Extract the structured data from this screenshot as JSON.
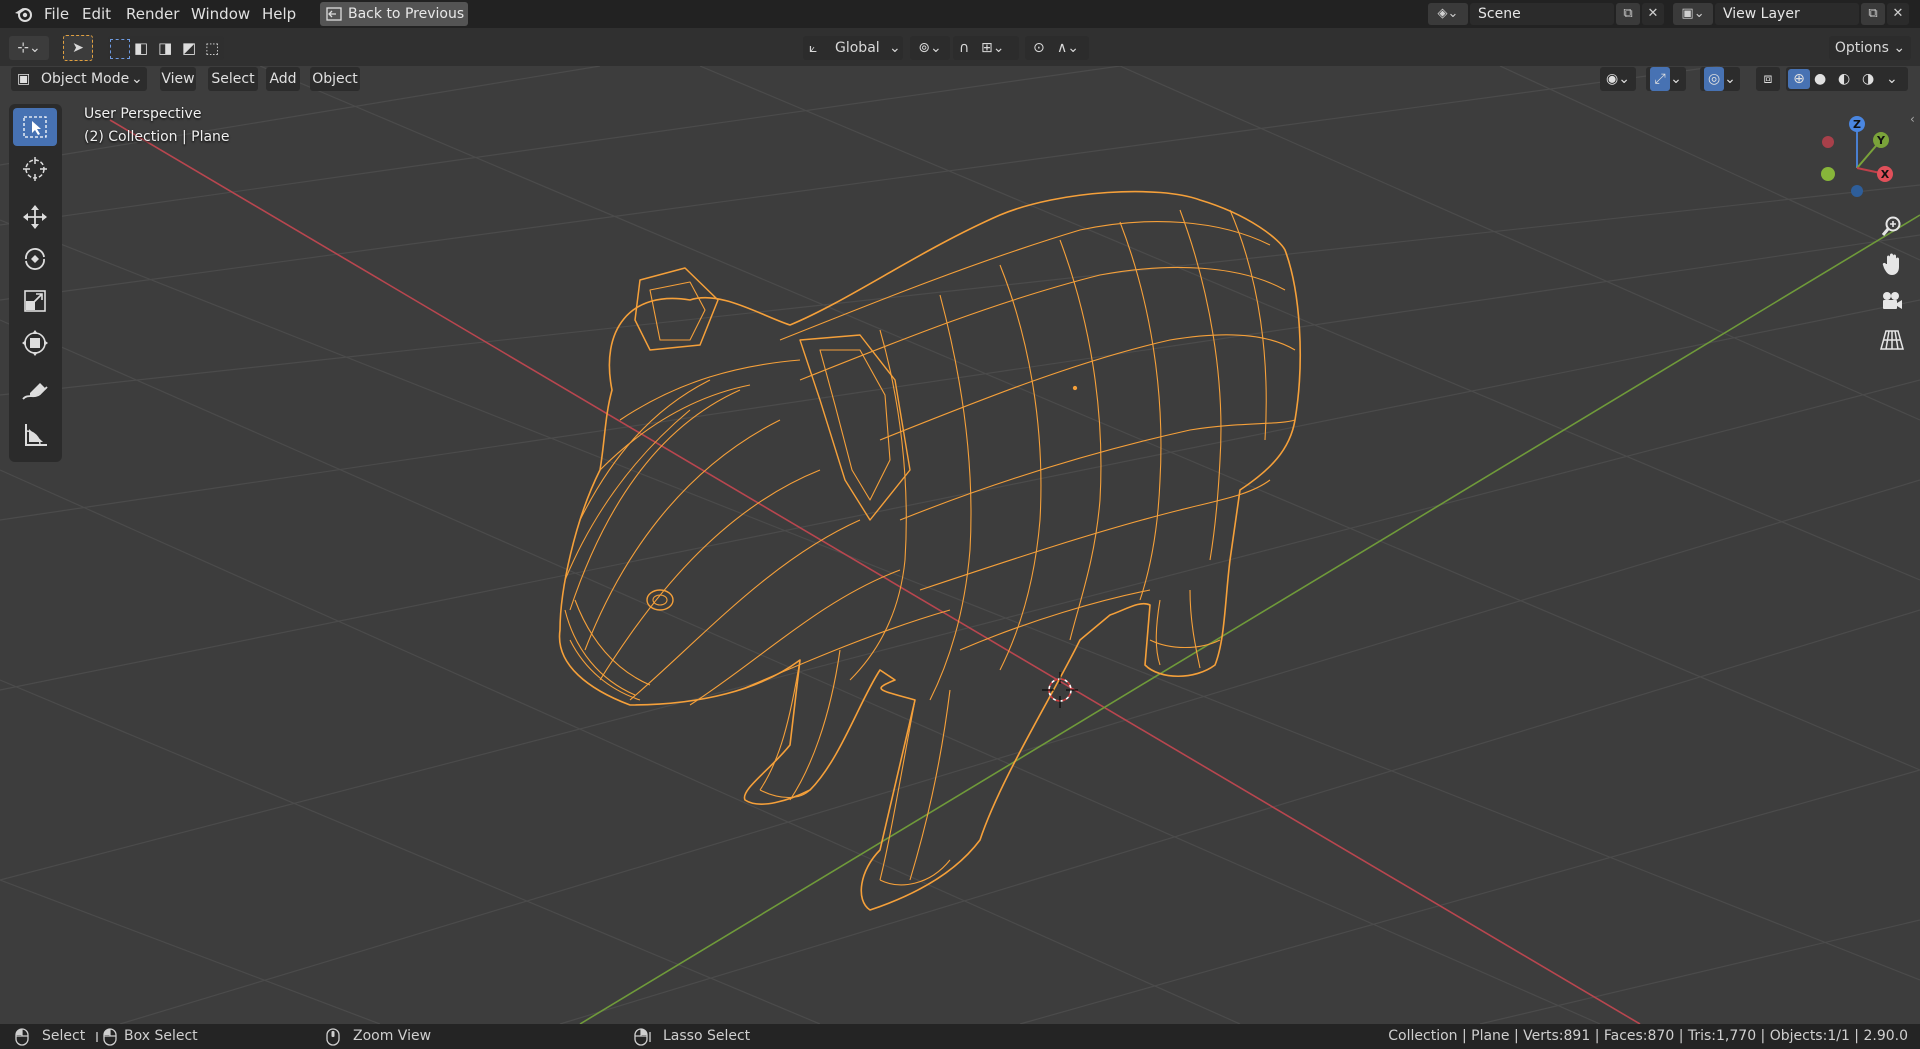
{
  "menubar": {
    "items": [
      "File",
      "Edit",
      "Render",
      "Window",
      "Help"
    ],
    "back_to_previous": "Back to Previous",
    "scene_label": "Scene",
    "view_layer_label": "View Layer"
  },
  "tool_header": {
    "transform_orientation": "Global",
    "options_label": "Options"
  },
  "viewport_header": {
    "mode": "Object Mode",
    "menus": [
      "View",
      "Select",
      "Add",
      "Object"
    ]
  },
  "viewport": {
    "perspective_label": "User Perspective",
    "collection_label": "(2) Collection | Plane",
    "gizmo_axes": {
      "z": "Z",
      "y": "Y",
      "x": "X"
    },
    "colors": {
      "wire": "#f5a03a",
      "x_axis": "#c0404a",
      "y_axis": "#6fa53a",
      "grid": "#4d4d4d",
      "background": "#3d3d3d",
      "active_tool": "#4772b3"
    }
  },
  "toolbar": {
    "tools": [
      {
        "icon": "select-box-icon",
        "active": true
      },
      {
        "icon": "cursor-icon",
        "active": false
      },
      {
        "icon": "move-icon",
        "active": false
      },
      {
        "icon": "rotate-icon",
        "active": false
      },
      {
        "icon": "scale-icon",
        "active": false
      },
      {
        "icon": "transform-icon",
        "active": false
      },
      {
        "icon": "annotate-icon",
        "active": false
      },
      {
        "icon": "measure-icon",
        "active": false
      }
    ]
  },
  "navigation": {
    "buttons": [
      "zoom-icon",
      "pan-hand-icon",
      "camera-icon",
      "grid-perspective-icon"
    ]
  },
  "statusbar": {
    "select": "Select",
    "box_select": "Box Select",
    "zoom_view": "Zoom View",
    "lasso_select": "Lasso Select",
    "stats": "Collection | Plane | Verts:891 | Faces:870 | Tris:1,770 | Objects:1/1 | 2.90.0"
  }
}
